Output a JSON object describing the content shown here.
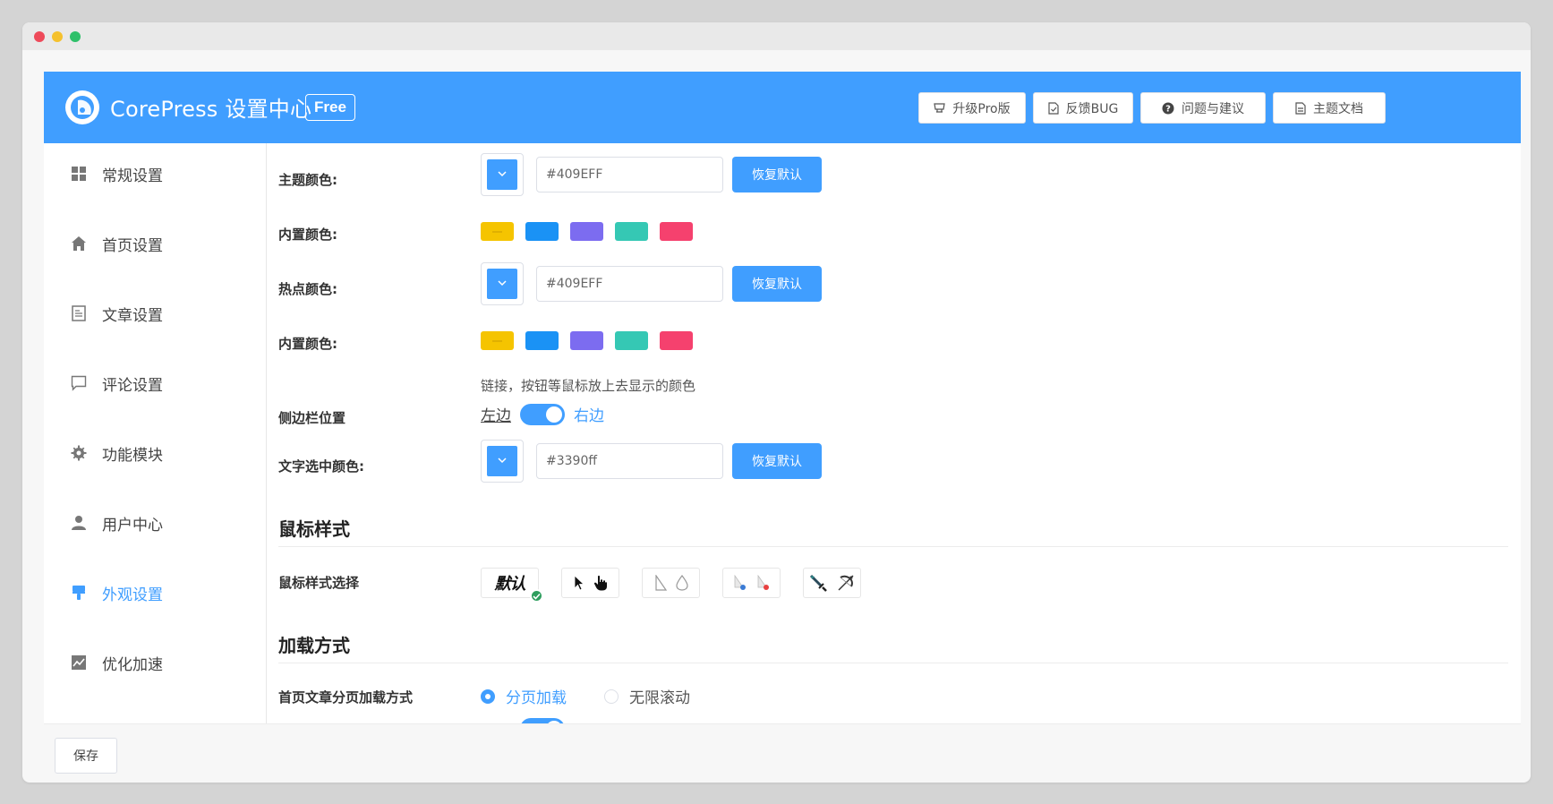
{
  "header": {
    "brand": "CorePress 设置中心",
    "badge": "Free",
    "buttons": [
      {
        "label": "升级Pro版",
        "icon": "crown-icon"
      },
      {
        "label": "反馈BUG",
        "icon": "file-check-icon"
      },
      {
        "label": "问题与建议",
        "icon": "question-circle-icon"
      },
      {
        "label": "主题文档",
        "icon": "document-icon"
      }
    ]
  },
  "sidebar": {
    "items": [
      {
        "label": "常规设置",
        "icon": "grid-icon"
      },
      {
        "label": "首页设置",
        "icon": "home-icon"
      },
      {
        "label": "文章设置",
        "icon": "article-icon"
      },
      {
        "label": "评论设置",
        "icon": "comment-icon"
      },
      {
        "label": "功能模块",
        "icon": "gear-icon"
      },
      {
        "label": "用户中心",
        "icon": "user-icon"
      },
      {
        "label": "外观设置",
        "icon": "paint-brush-icon"
      },
      {
        "label": "优化加速",
        "icon": "chart-icon"
      }
    ],
    "active_index": 6
  },
  "theme_color": {
    "label": "主题颜色:",
    "value": "#409EFF",
    "reset": "恢复默认"
  },
  "preset_colors_1": {
    "label": "内置颜色:",
    "colors": [
      "#f5c400",
      "#1a92f5",
      "#7c6cf0",
      "#35c8b4",
      "#f5416e"
    ]
  },
  "hot_color": {
    "label": "热点颜色:",
    "value": "#409EFF",
    "reset": "恢复默认"
  },
  "preset_colors_2": {
    "label": "内置颜色:",
    "colors": [
      "#f5c400",
      "#1a92f5",
      "#7c6cf0",
      "#35c8b4",
      "#f5416e"
    ]
  },
  "hot_hint": "链接，按钮等鼠标放上去显示的颜色",
  "sidebar_position": {
    "label": "侧边栏位置",
    "off": "左边",
    "on": "右边"
  },
  "select_color": {
    "label": "文字选中颜色:",
    "value": "#3390ff",
    "reset": "恢复默认"
  },
  "mouse_section": {
    "title": "鼠标样式",
    "label": "鼠标样式选择",
    "default_text": "默认"
  },
  "load_section": {
    "title": "加载方式",
    "label": "首页文章分页加载方式",
    "options": [
      "分页加载",
      "无限滚动"
    ]
  },
  "footer": {
    "save": "保存"
  },
  "colors": {
    "accent": "#409eff"
  }
}
